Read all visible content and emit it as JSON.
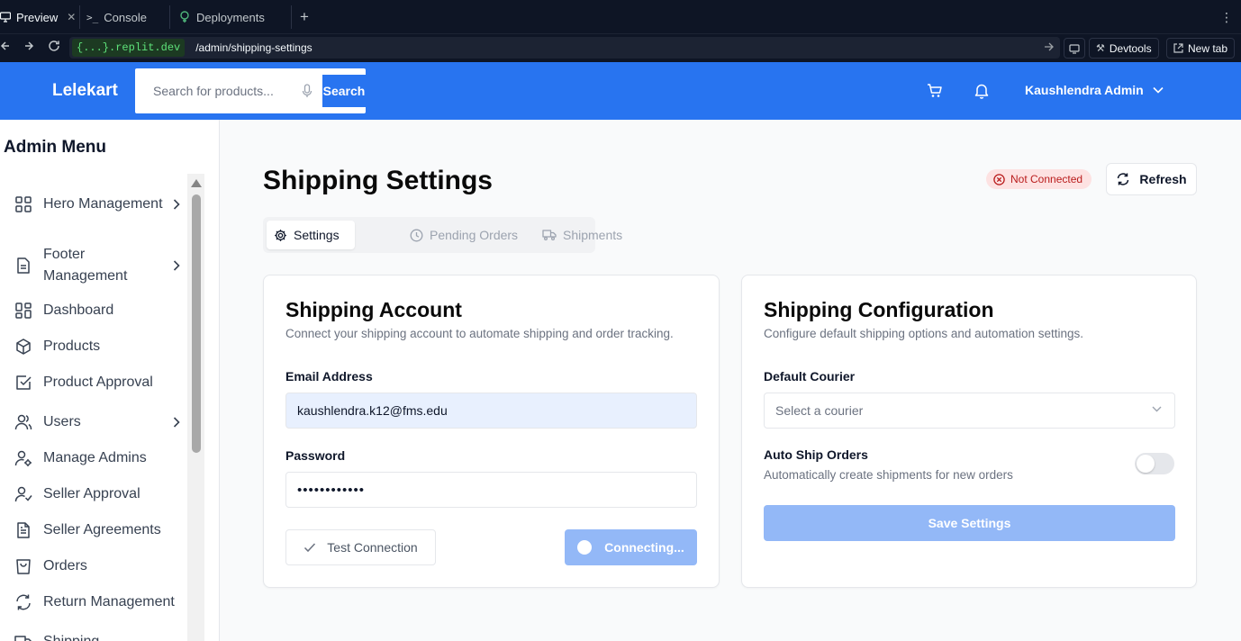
{
  "browser": {
    "tabs": [
      {
        "label": "Preview",
        "active": true
      },
      {
        "label": "Console",
        "active": false
      },
      {
        "label": "Deployments",
        "active": false
      }
    ],
    "url_host": "{...}.replit.dev",
    "url_path": "/admin/shipping-settings",
    "devtools_label": "Devtools",
    "newtab_label": "New tab"
  },
  "header": {
    "brand": "Lelekart",
    "search_placeholder": "Search for products...",
    "search_button": "Search",
    "user_name": "Kaushlendra Admin"
  },
  "sidebar": {
    "title": "Admin Menu",
    "items": [
      {
        "label": "Hero Management",
        "icon": "grid-icon",
        "has_submenu": true
      },
      {
        "label": "Footer Management",
        "icon": "document-icon",
        "has_submenu": true
      },
      {
        "label": "Dashboard",
        "icon": "dashboard-icon",
        "has_submenu": false
      },
      {
        "label": "Products",
        "icon": "box-icon",
        "has_submenu": false
      },
      {
        "label": "Product Approval",
        "icon": "check-square-icon",
        "has_submenu": false
      },
      {
        "label": "Users",
        "icon": "users-icon",
        "has_submenu": true
      },
      {
        "label": "Manage Admins",
        "icon": "user-cog-icon",
        "has_submenu": false
      },
      {
        "label": "Seller Approval",
        "icon": "user-check-icon",
        "has_submenu": false
      },
      {
        "label": "Seller Agreements",
        "icon": "file-text-icon",
        "has_submenu": false
      },
      {
        "label": "Orders",
        "icon": "shopping-bag-icon",
        "has_submenu": false
      },
      {
        "label": "Return Management",
        "icon": "refresh-icon",
        "has_submenu": false
      },
      {
        "label": "Shipping",
        "icon": "truck-icon",
        "has_submenu": false
      }
    ]
  },
  "page": {
    "title": "Shipping Settings",
    "status": "Not Connected",
    "refresh": "Refresh",
    "tabs": [
      {
        "label": "Settings",
        "icon": "gear-icon",
        "active": true
      },
      {
        "label": "Pending Orders",
        "icon": "clock-icon",
        "active": false
      },
      {
        "label": "Shipments",
        "icon": "truck-icon",
        "active": false
      }
    ]
  },
  "account_card": {
    "title": "Shipping Account",
    "description": "Connect your shipping account to automate shipping and order tracking.",
    "email_label": "Email Address",
    "email_value": "kaushlendra.k12@fms.edu",
    "password_label": "Password",
    "password_value": "••••••••••••",
    "test_button": "Test Connection",
    "connect_button": "Connecting..."
  },
  "config_card": {
    "title": "Shipping Configuration",
    "description": "Configure default shipping options and automation settings.",
    "courier_label": "Default Courier",
    "courier_placeholder": "Select a courier",
    "auto_ship_label": "Auto Ship Orders",
    "auto_ship_desc": "Automatically create shipments for new orders",
    "auto_ship_enabled": false,
    "save_button": "Save Settings"
  },
  "colors": {
    "brand_blue": "#2874f0",
    "disabled_blue": "#93b8f7",
    "danger": "#b91c1c"
  }
}
